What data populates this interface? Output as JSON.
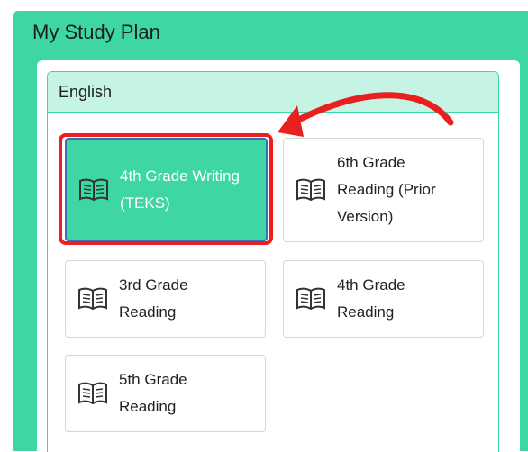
{
  "panel": {
    "title": "My Study Plan"
  },
  "section": {
    "title": "English"
  },
  "courses": [
    {
      "label": "4th Grade Writing (TEKS)",
      "active": true
    },
    {
      "label": "6th Grade Reading (Prior Version)",
      "active": false
    },
    {
      "label": "3rd Grade Reading",
      "active": false
    },
    {
      "label": "4th Grade Reading",
      "active": false
    },
    {
      "label": "5th Grade Reading",
      "active": false
    }
  ],
  "icons": {
    "course": "book-icon"
  },
  "colors": {
    "panel_green": "#3dd6a4",
    "header_mint": "#c6f4e4",
    "annotation_red": "#ea2020",
    "active_border_blue": "#3a6fb8"
  }
}
